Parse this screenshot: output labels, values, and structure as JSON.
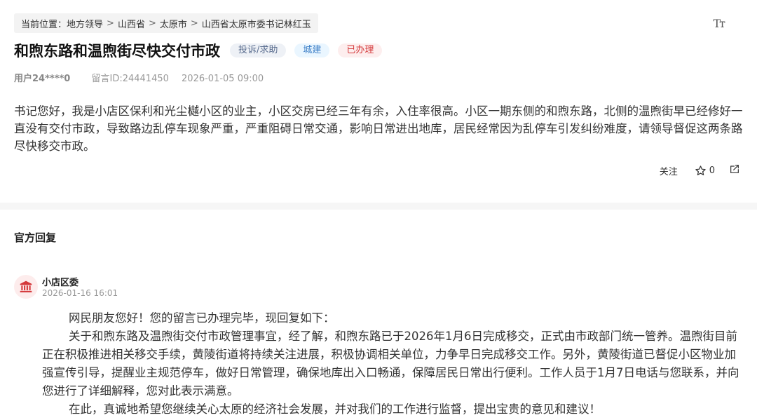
{
  "breadcrumb": {
    "prefix": "当前位置：",
    "items": [
      "地方领导",
      "山西省",
      "太原市",
      "山西省太原市委书记林红玉"
    ],
    "separator": ">"
  },
  "font_toggle_label": "Tт",
  "post": {
    "title": "和煦东路和温煦街尽快交付市政",
    "tags": {
      "category": "投诉/求助",
      "field": "城建",
      "status": "已办理"
    },
    "colors": {
      "status": "#d4393b",
      "field": "#3d7fc7",
      "category": "#5a6d8f"
    },
    "user": "用户24****0",
    "message_id": "留言ID:24441450",
    "time": "2026-01-05 09:00",
    "content": "书记您好，我是小店区保利和光尘樾小区的业主，小区交房已经三年有余，入住率很高。小区一期东侧的和煦东路，北侧的温煦街早已经修好一直没有交付市政，导致路边乱停车现象严重，严重阻碍日常交通，影响日常进出地库，居民经常因为乱停车引发纠纷难度，请领导督促这两条路尽快移交市政。"
  },
  "actions": {
    "follow_label": "关注",
    "like_count": "0",
    "like_icon": "star-outline-icon",
    "share_icon": "share-icon"
  },
  "reply_section": {
    "title": "官方回复",
    "org_icon": "government-building-icon",
    "org_name": "小店区委",
    "time": "2026-01-16 16:01",
    "paragraphs": [
      "网民朋友您好！您的留言已办理完毕，现回复如下：",
      "关于和煦东路及温煦街交付市政管理事宜，经了解，和煦东路已于2026年1月6日完成移交，正式由市政部门统一管养。温煦街目前正在积极推进相关移交手续，黄陵街道将持续关注进展，积极协调相关单位，力争早日完成移交工作。另外，黄陵街道已督促小区物业加强宣传引导，提醒业主规范停车，做好日常管理，确保地库出入口畅通，保障居民日常出行便利。工作人员于1月7日电话与您联系，并向您进行了详细解释，您对此表示满意。",
      "在此，真诚地希望您继续关心太原的经济社会发展，并对我们的工作进行监督，提出宝贵的意见和建议！"
    ]
  }
}
